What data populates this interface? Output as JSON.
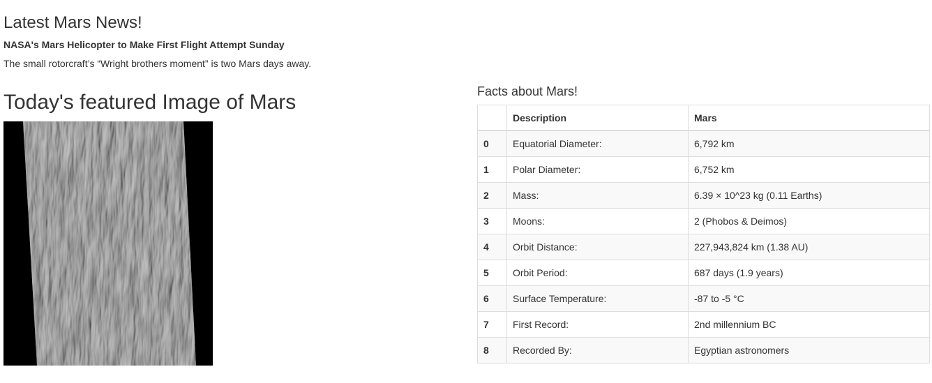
{
  "news": {
    "section_title": "Latest Mars News!",
    "headline": "NASA's Mars Helicopter to Make First Flight Attempt Sunday",
    "teaser": "The small rotorcraft’s “Wright brothers moment” is two Mars days away."
  },
  "featured": {
    "section_title": "Today's featured Image of Mars",
    "image_alt": "featured Mars image"
  },
  "facts": {
    "section_title": "Facts about Mars!",
    "columns": [
      "",
      "Description",
      "Mars"
    ],
    "rows": [
      {
        "index": "0",
        "description": "Equatorial Diameter:",
        "value": "6,792 km"
      },
      {
        "index": "1",
        "description": "Polar Diameter:",
        "value": "6,752 km"
      },
      {
        "index": "2",
        "description": "Mass:",
        "value": "6.39 × 10^23 kg (0.11 Earths)"
      },
      {
        "index": "3",
        "description": "Moons:",
        "value": "2 (Phobos & Deimos)"
      },
      {
        "index": "4",
        "description": "Orbit Distance:",
        "value": "227,943,824 km (1.38 AU)"
      },
      {
        "index": "5",
        "description": "Orbit Period:",
        "value": "687 days (1.9 years)"
      },
      {
        "index": "6",
        "description": "Surface Temperature:",
        "value": "-87 to -5 °C"
      },
      {
        "index": "7",
        "description": "First Record:",
        "value": "2nd millennium BC"
      },
      {
        "index": "8",
        "description": "Recorded By:",
        "value": "Egyptian astronomers"
      }
    ]
  },
  "colors": {
    "text": "#333333",
    "border": "#dddddd",
    "stripe": "#f9f9f9"
  }
}
